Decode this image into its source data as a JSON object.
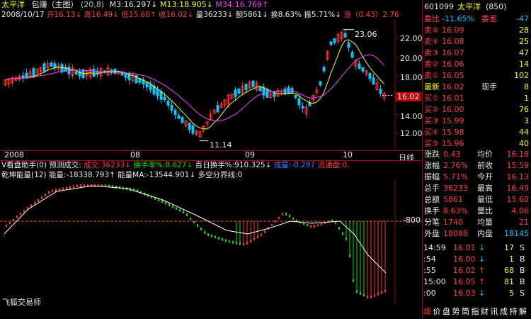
{
  "colors": {
    "up": "#ff3030",
    "down": "#00c8ff",
    "ma3": "#ffffff",
    "ma13": "#ffff00",
    "ma34": "#ff40ff",
    "axis": "#a00000",
    "label": "#ff3030"
  },
  "header": {
    "stock_name": "太平洋",
    "title_parts": [
      "包赚（主图）",
      "(20,8)",
      "M3:16.297",
      "↓",
      "M13:18.905",
      "↓",
      "M34:16.769",
      "↑"
    ]
  },
  "info_line": {
    "date": "2008/10/17",
    "open": "开16.13",
    "open_dir": "↓",
    "high": "高16.49",
    "high_dir": "↓",
    "low": "低15.60",
    "low_dir": "↑",
    "close": "收16.02",
    "close_dir": "↓",
    "volume": "量36233",
    "vol_dir": "↓",
    "amount": "额5861",
    "amt_dir": "↓",
    "turnover": "换8.63%",
    "amplitude": "振5.71%",
    "amp_dir": "↓",
    "change": "涨（0.43）2.76"
  },
  "price_axis": {
    "labels": [
      "22.00",
      "20.00",
      "18.00",
      "16.00",
      "14.00",
      "12.00"
    ],
    "current": "16.02"
  },
  "annotations": {
    "high": "23.06",
    "low": "11.14"
  },
  "date_axis": {
    "labels": [
      "2008",
      "08",
      "09",
      "10"
    ],
    "unit": "日线"
  },
  "indicator1": {
    "title": "V看盘助手(0)",
    "item1": "预测成交:",
    "item2": "成交:36233",
    "item2_dir": "↓",
    "item3": "换手率%:8.627",
    "item3_dir": "↓",
    "item4": "百日换手%:910.325",
    "item4_dir": "↓",
    "item5": "成量:-0.297",
    "item6": "流通盘:0."
  },
  "indicator2": {
    "title": "乾坤能量(12)",
    "energy": "能量:-18338.793",
    "energy_dir": "↑",
    "energy_ma": "能量MA:-13544.901",
    "energy_ma_dir": "↓",
    "bound": "多空分界线:0",
    "axis_label": "-800"
  },
  "watermark": "飞狐交易师",
  "quote": {
    "code": "601099",
    "name": "太平洋",
    "extra": "(850)",
    "wei_bi_label": "委比",
    "wei_bi": "-11.65%",
    "wei_cha_label": "委差",
    "wei_cha": "-47",
    "sells": [
      {
        "label": "卖⑤",
        "price": "16.09",
        "vol": "28"
      },
      {
        "label": "卖④",
        "price": "16.08",
        "vol": "25"
      },
      {
        "label": "卖③",
        "price": "16.07",
        "vol": "47"
      },
      {
        "label": "卖②",
        "price": "16.06",
        "vol": "14"
      },
      {
        "label": "卖①",
        "price": "16.05",
        "vol": "102"
      }
    ],
    "latest_label": "最新",
    "latest": "16.02",
    "now_label": "现手",
    "now": "8",
    "buys": [
      {
        "label": "买①",
        "price": "16.01",
        "vol": "1"
      },
      {
        "label": "买②",
        "price": "16.00",
        "vol": "76"
      },
      {
        "label": "买③",
        "price": "15.99",
        "vol": "3"
      },
      {
        "label": "买④",
        "price": "15.98",
        "vol": "44"
      },
      {
        "label": "买⑤",
        "price": "15.96",
        "vol": "40"
      }
    ],
    "stats": [
      {
        "l": "涨跌",
        "lv": "0.43",
        "r": "均价",
        "rv": "16.18"
      },
      {
        "l": "涨幅",
        "lv": "2.76%",
        "r": "前收",
        "rv": "15.59"
      },
      {
        "l": "振幅",
        "lv": "5.71%",
        "r": "今开",
        "rv": "16.13"
      },
      {
        "l": "总手",
        "lv": "36233",
        "r": "最高",
        "rv": "16.49"
      },
      {
        "l": "总额",
        "lv": "5861",
        "r": "最低",
        "rv": "15.60"
      },
      {
        "l": "换手",
        "lv": "8.63%",
        "r": "量比",
        "rv": "4.06"
      },
      {
        "l": "分笔",
        "lv": "1740",
        "r": "均量",
        "rv": "21"
      }
    ],
    "outer_label": "外盘",
    "outer": "18088",
    "inner_label": "内盘",
    "inner": "18145",
    "ticks": [
      {
        "t": "14:59",
        "p": "16.01",
        "d": "↓",
        "v": "17",
        "s": "S"
      },
      {
        "t": ":54",
        "p": "16.00",
        "d": "↓",
        "v": "1",
        "s": "B"
      },
      {
        "t": ":55",
        "p": "16.02",
        "d": "↑",
        "v": "68",
        "s": "B"
      },
      {
        "t": "15:00",
        "p": "16.05",
        "d": "↑",
        "v": "81",
        "s": "B"
      },
      {
        "t": ":00",
        "p": "16.03",
        "d": "↓",
        "v": "5",
        "s": "S"
      }
    ],
    "bottom_tabs": [
      "细",
      "价",
      "盘",
      "势",
      "筒",
      "指",
      "财",
      "讯",
      "成",
      "持",
      "解"
    ]
  }
}
